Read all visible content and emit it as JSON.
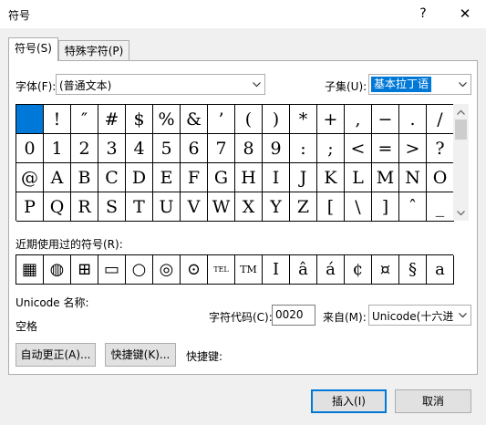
{
  "window": {
    "title": "符号",
    "help_label": "?",
    "close_label": "✕"
  },
  "tabs": [
    {
      "label": "符号(S)",
      "active": true
    },
    {
      "label": "特殊字符(P)",
      "active": false
    }
  ],
  "font": {
    "label": "字体(F):",
    "value": "(普通文本)"
  },
  "subset": {
    "label": "子集(U):",
    "value": "基本拉丁语"
  },
  "symbol_grid": [
    [
      "",
      "!",
      "″",
      "#",
      "$",
      "%",
      "&",
      "’",
      "(",
      ")",
      "*",
      "+",
      ",",
      "−",
      ".",
      "/"
    ],
    [
      "0",
      "1",
      "2",
      "3",
      "4",
      "5",
      "6",
      "7",
      "8",
      "9",
      ":",
      ";",
      "<",
      "=",
      ">",
      "?"
    ],
    [
      "@",
      "A",
      "B",
      "C",
      "D",
      "E",
      "F",
      "G",
      "H",
      "I",
      "J",
      "K",
      "L",
      "M",
      "N",
      "O"
    ],
    [
      "P",
      "Q",
      "R",
      "S",
      "T",
      "U",
      "V",
      "W",
      "X",
      "Y",
      "Z",
      "[",
      "\\",
      "]",
      "ˆ",
      "_"
    ]
  ],
  "recent": {
    "label": "近期使用过的符号(R):",
    "symbols": [
      "▦",
      "◍",
      "⊞",
      "▭",
      "○",
      "◎",
      "⊙",
      "TEL",
      "TM",
      "I",
      "â",
      "á",
      "¢",
      "¤",
      "§",
      "a"
    ]
  },
  "unicode_name": {
    "label": "Unicode 名称:",
    "value": "空格"
  },
  "char_code": {
    "label": "字符代码(C):",
    "value": "0020"
  },
  "from": {
    "label": "来自(M):",
    "value": "Unicode(十六进"
  },
  "buttons": {
    "autocorrect": "自动更正(A)...",
    "shortcut_key": "快捷键(K)...",
    "shortcut_label": "快捷键:",
    "insert": "插入(I)",
    "cancel": "取消"
  },
  "colors": {
    "selection": "#0078d7",
    "background": "#f0f0f0"
  }
}
